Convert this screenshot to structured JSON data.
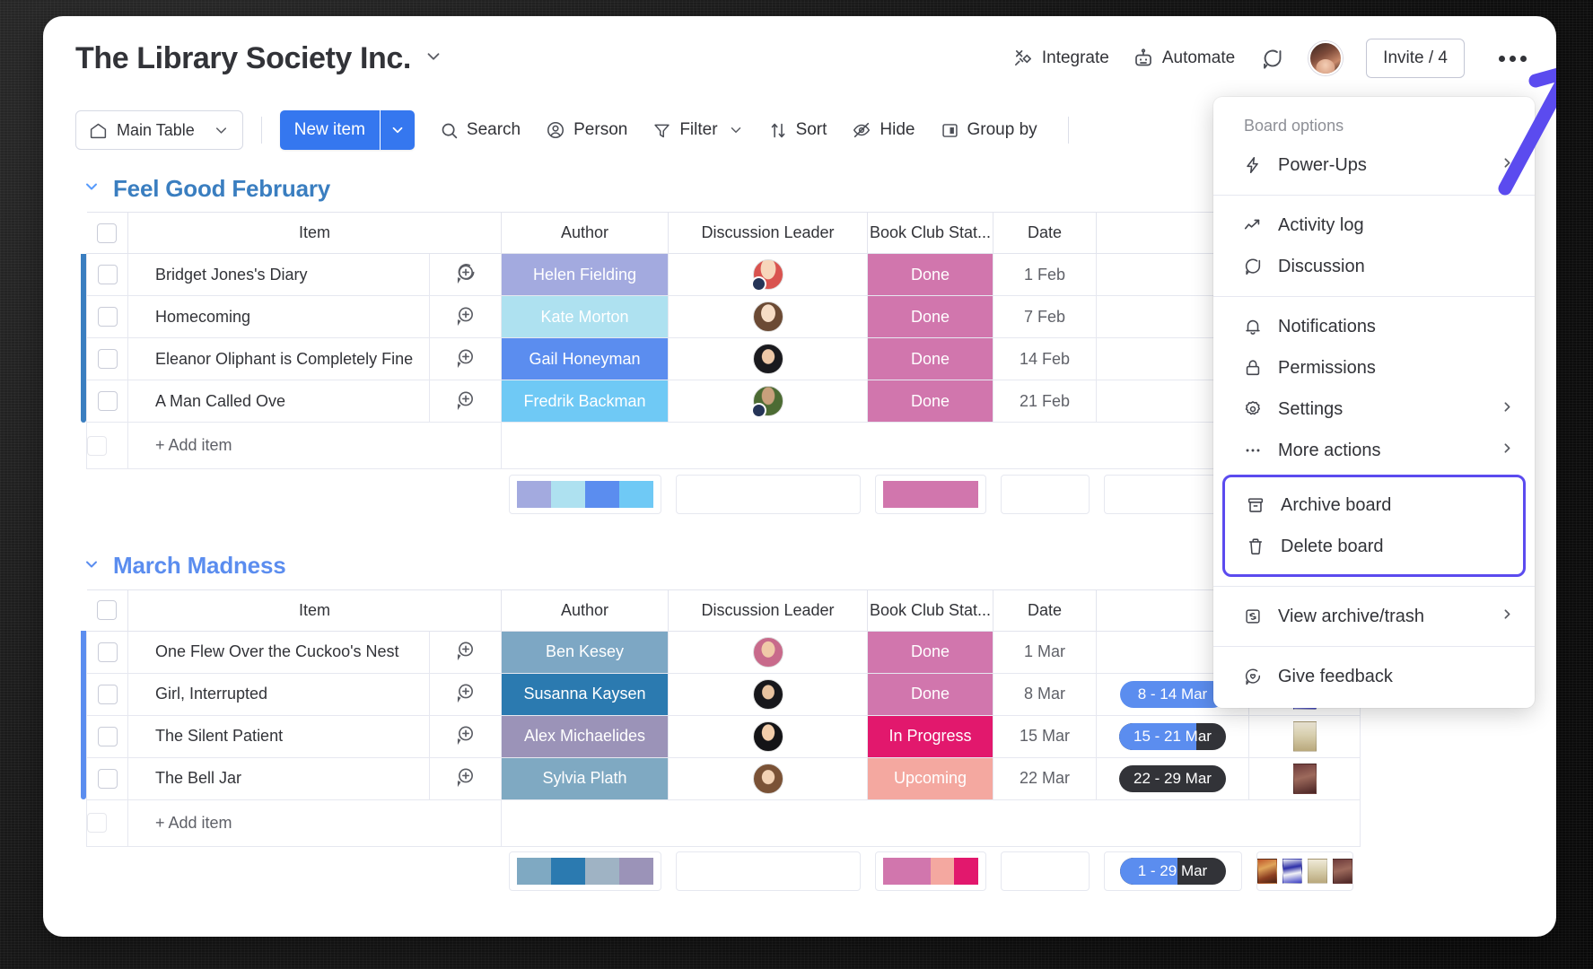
{
  "header": {
    "title": "The Library Society Inc.",
    "caret": "chevron-down",
    "actions": [
      {
        "label": "Integrate",
        "icon": "integrate-icon"
      },
      {
        "label": "Automate",
        "icon": "robot-icon"
      }
    ],
    "chat_icon": "chat-bubble-icon",
    "invite_label": "Invite / 4",
    "kebab_icon": "more-options-icon"
  },
  "toolbar": {
    "view": {
      "label": "Main Table",
      "icon": "home-icon",
      "caret": "chevron-down"
    },
    "new_item": {
      "label": "New item",
      "caret": "chevron-down",
      "color": "#3577ef"
    },
    "items": [
      {
        "label": "Search",
        "icon": "search-icon",
        "caret": false
      },
      {
        "label": "Person",
        "icon": "person-icon",
        "caret": false
      },
      {
        "label": "Filter",
        "icon": "filter-icon",
        "caret": true
      },
      {
        "label": "Sort",
        "icon": "sort-icon",
        "caret": false
      },
      {
        "label": "Hide",
        "icon": "eye-off-icon",
        "caret": false
      },
      {
        "label": "Group by",
        "icon": "group-by-icon",
        "caret": false
      }
    ]
  },
  "menu": {
    "section_label": "Board options",
    "groups": [
      {
        "items": [
          {
            "label": "Power-Ups",
            "icon": "lightning-icon",
            "arrow": true
          }
        ]
      },
      {
        "items": [
          {
            "label": "Activity log",
            "icon": "activity-chart-icon",
            "arrow": false
          },
          {
            "label": "Discussion",
            "icon": "chat-bubble-icon",
            "arrow": false
          }
        ]
      },
      {
        "items": [
          {
            "label": "Notifications",
            "icon": "bell-icon",
            "arrow": false
          },
          {
            "label": "Permissions",
            "icon": "lock-icon",
            "arrow": false
          },
          {
            "label": "Settings",
            "icon": "gear-icon",
            "arrow": true
          },
          {
            "label": "More actions",
            "icon": "ellipsis-icon",
            "arrow": true
          }
        ]
      },
      {
        "highlighted": true,
        "highlight_color": "#5b4bef",
        "items": [
          {
            "label": "Archive board",
            "icon": "archive-icon",
            "arrow": false
          },
          {
            "label": "Delete board",
            "icon": "trash-icon",
            "arrow": false
          }
        ]
      },
      {
        "items": [
          {
            "label": "View archive/trash",
            "icon": "archive-restore-icon",
            "arrow": true
          }
        ]
      },
      {
        "items": [
          {
            "label": "Give feedback",
            "icon": "feedback-heart-icon",
            "arrow": false
          }
        ]
      }
    ]
  },
  "columns": [
    "Item",
    "Author",
    "Discussion Leader",
    "Book Club Stat...",
    "Date"
  ],
  "add_item_label": "+ Add item",
  "groups": [
    {
      "name": "Feel Good February",
      "color": "#3a7ec0",
      "chevron": "chevron-down",
      "rows": [
        {
          "item": "Bridget Jones's Diary",
          "author": "Helen Fielding",
          "author_color": "#a3aadf",
          "leader_avatar": "avatar-blonde-red",
          "leader_badge": true,
          "status": "Done",
          "status_color": "#d176ad",
          "date": "1 Feb",
          "timeline": null,
          "cover": null
        },
        {
          "item": "Homecoming",
          "author": "Kate Morton",
          "author_color": "#aee1f0",
          "leader_avatar": "avatar-brunette",
          "leader_badge": false,
          "status": "Done",
          "status_color": "#d176ad",
          "date": "7 Feb",
          "timeline": null,
          "cover": null
        },
        {
          "item": "Eleanor Oliphant is Completely Fine",
          "author": "Gail Honeyman",
          "author_color": "#5b8def",
          "leader_avatar": "avatar-dark-hair",
          "leader_badge": false,
          "status": "Done",
          "status_color": "#d176ad",
          "date": "14 Feb",
          "timeline": null,
          "cover": null
        },
        {
          "item": "A Man Called Ove",
          "author": "Fredrik Backman",
          "author_color": "#6fc9f5",
          "leader_avatar": "avatar-green-top",
          "leader_badge": true,
          "status": "Done",
          "status_color": "#d176ad",
          "date": "21 Feb",
          "timeline": null,
          "cover": null
        }
      ],
      "summary": {
        "author_segments": [
          "#a3aadf",
          "#aee1f0",
          "#5b8def",
          "#6fc9f5"
        ],
        "status_segments": [
          "#d176ad"
        ],
        "timeline": null,
        "covers": []
      }
    },
    {
      "name": "March Madness",
      "color": "#5b8def",
      "chevron": "chevron-down",
      "rows": [
        {
          "item": "One Flew Over the Cuckoo's Nest",
          "author": "Ben Kesey",
          "author_color": "#7da7c4",
          "leader_avatar": "avatar-pink-bg",
          "leader_badge": false,
          "status": "Done",
          "status_color": "#d176ad",
          "date": "1 Mar",
          "timeline": null,
          "cover": null
        },
        {
          "item": "Girl, Interrupted",
          "author": "Susanna Kaysen",
          "author_color": "#2b7ab0",
          "leader_avatar": "avatar-dark-curly",
          "leader_badge": false,
          "status": "Done",
          "status_color": "#d176ad",
          "date": "8 Mar",
          "timeline": {
            "label": "8 - 14 Mar",
            "progress": 100,
            "style": "full"
          },
          "cover": "cov-girl"
        },
        {
          "item": "The Silent Patient",
          "author": "Alex Michaelides",
          "author_color": "#9b93b8",
          "leader_avatar": "avatar-dark-long",
          "leader_badge": false,
          "status": "In Progress",
          "status_color": "#e2186d",
          "date": "15 Mar",
          "timeline": {
            "label": "15 - 21 Mar",
            "progress": 72,
            "style": "split"
          },
          "cover": "cov-silent"
        },
        {
          "item": "The Bell Jar",
          "author": "Sylvia Plath",
          "author_color": "#7fa9c2",
          "leader_avatar": "avatar-long-brown",
          "leader_badge": false,
          "status": "Upcoming",
          "status_color": "#f4a8a0",
          "date": "22 Mar",
          "timeline": {
            "label": "22 - 29 Mar",
            "progress": 0,
            "style": "dark"
          },
          "cover": "cov-bell"
        }
      ],
      "summary": {
        "author_segments": [
          "#7fa9c2",
          "#2b7ab0",
          "#9fb3c4",
          "#9b93b8"
        ],
        "status_segments": [
          "#d176ad",
          "#f4a8a0",
          "#e2186d"
        ],
        "timeline": {
          "label": "1 - 29 Mar",
          "progress": 52,
          "style": "split"
        },
        "covers": [
          "cov-cuckoo",
          "cov-girl",
          "cov-silent",
          "cov-bell"
        ]
      }
    }
  ],
  "annotation": {
    "arrow_color": "#5b4bef"
  }
}
